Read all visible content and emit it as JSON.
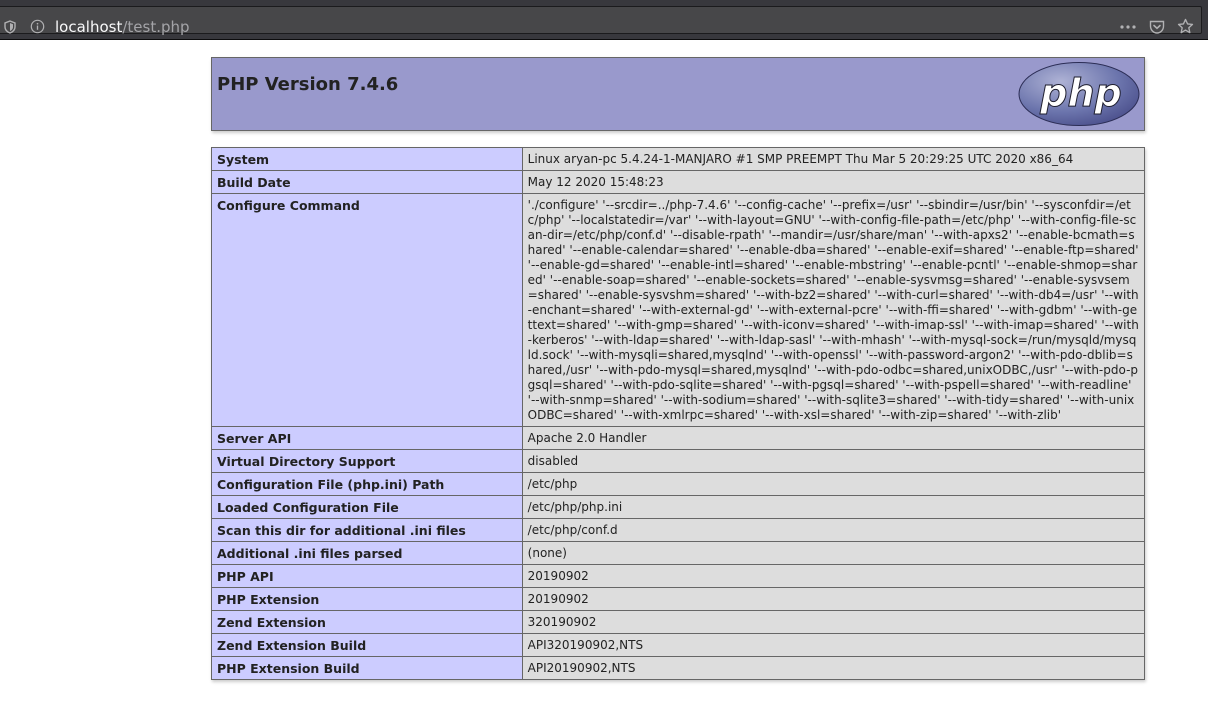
{
  "browser": {
    "url_host": "localhost",
    "url_path": "/test.php",
    "icons": [
      "shield-icon",
      "info-icon",
      "more-icon",
      "pocket-icon",
      "star-icon"
    ]
  },
  "header": {
    "title": "PHP Version 7.4.6",
    "logo_text": "php"
  },
  "colors": {
    "header_bg": "#9999cc",
    "key_bg": "#ccccff",
    "value_bg": "#dddddd",
    "border": "#666666"
  },
  "rows": [
    {
      "key": "System",
      "value": "Linux aryan-pc 5.4.24-1-MANJARO #1 SMP PREEMPT Thu Mar 5 20:29:25 UTC 2020 x86_64"
    },
    {
      "key": "Build Date",
      "value": "May 12 2020 15:48:23"
    },
    {
      "key": "Configure Command",
      "value": "'./configure' '--srcdir=../php-7.4.6' '--config-cache' '--prefix=/usr' '--sbindir=/usr/bin' '--sysconfdir=/etc/php' '--localstatedir=/var' '--with-layout=GNU' '--with-config-file-path=/etc/php' '--with-config-file-scan-dir=/etc/php/conf.d' '--disable-rpath' '--mandir=/usr/share/man' '--with-apxs2' '--enable-bcmath=shared' '--enable-calendar=shared' '--enable-dba=shared' '--enable-exif=shared' '--enable-ftp=shared' '--enable-gd=shared' '--enable-intl=shared' '--enable-mbstring' '--enable-pcntl' '--enable-shmop=shared' '--enable-soap=shared' '--enable-sockets=shared' '--enable-sysvmsg=shared' '--enable-sysvsem=shared' '--enable-sysvshm=shared' '--with-bz2=shared' '--with-curl=shared' '--with-db4=/usr' '--with-enchant=shared' '--with-external-gd' '--with-external-pcre' '--with-ffi=shared' '--with-gdbm' '--with-gettext=shared' '--with-gmp=shared' '--with-iconv=shared' '--with-imap-ssl' '--with-imap=shared' '--with-kerberos' '--with-ldap=shared' '--with-ldap-sasl' '--with-mhash' '--with-mysql-sock=/run/mysqld/mysqld.sock' '--with-mysqli=shared,mysqlnd' '--with-openssl' '--with-password-argon2' '--with-pdo-dblib=shared,/usr' '--with-pdo-mysql=shared,mysqlnd' '--with-pdo-odbc=shared,unixODBC,/usr' '--with-pdo-pgsql=shared' '--with-pdo-sqlite=shared' '--with-pgsql=shared' '--with-pspell=shared' '--with-readline' '--with-snmp=shared' '--with-sodium=shared' '--with-sqlite3=shared' '--with-tidy=shared' '--with-unixODBC=shared' '--with-xmlrpc=shared' '--with-xsl=shared' '--with-zip=shared' '--with-zlib'"
    },
    {
      "key": "Server API",
      "value": "Apache 2.0 Handler"
    },
    {
      "key": "Virtual Directory Support",
      "value": "disabled"
    },
    {
      "key": "Configuration File (php.ini) Path",
      "value": "/etc/php"
    },
    {
      "key": "Loaded Configuration File",
      "value": "/etc/php/php.ini"
    },
    {
      "key": "Scan this dir for additional .ini files",
      "value": "/etc/php/conf.d"
    },
    {
      "key": "Additional .ini files parsed",
      "value": "(none)"
    },
    {
      "key": "PHP API",
      "value": "20190902"
    },
    {
      "key": "PHP Extension",
      "value": "20190902"
    },
    {
      "key": "Zend Extension",
      "value": "320190902"
    },
    {
      "key": "Zend Extension Build",
      "value": "API320190902,NTS"
    },
    {
      "key": "PHP Extension Build",
      "value": "API20190902,NTS"
    }
  ]
}
